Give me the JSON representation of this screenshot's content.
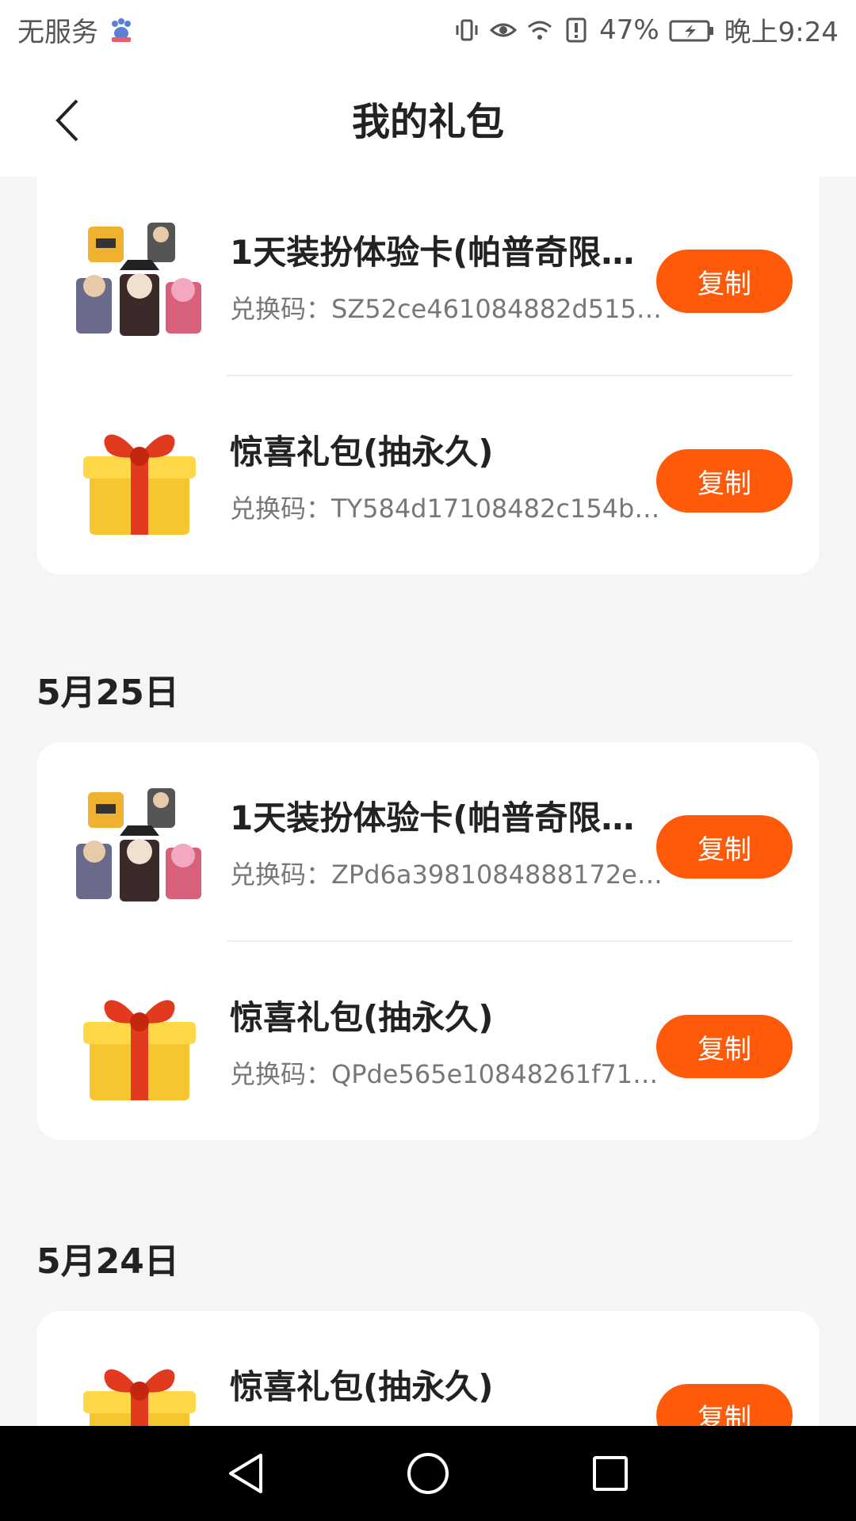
{
  "status_bar": {
    "carrier": "无服务",
    "battery": "47%",
    "time": "晚上9:24"
  },
  "header": {
    "title": "我的礼包"
  },
  "groups": [
    {
      "date": "",
      "items": [
        {
          "title": "1天装扮体验卡(帕普奇限…",
          "code": "兑换码：SZ52ce461084882d515…",
          "button": "复制",
          "icon": "characters-icon"
        },
        {
          "title": "惊喜礼包(抽永久)",
          "code": "兑换码：TY584d17108482c154b…",
          "button": "复制",
          "icon": "gift-box-icon"
        }
      ]
    },
    {
      "date": "5月25日",
      "items": [
        {
          "title": "1天装扮体验卡(帕普奇限…",
          "code": "兑换码：ZPd6a3981084888172e…",
          "button": "复制",
          "icon": "characters-icon"
        },
        {
          "title": "惊喜礼包(抽永久)",
          "code": "兑换码：QPde565e10848261f71…",
          "button": "复制",
          "icon": "gift-box-icon"
        }
      ]
    },
    {
      "date": "5月24日",
      "items": [
        {
          "title": "惊喜礼包(抽永久)",
          "code": "",
          "button": "复制",
          "icon": "gift-box-icon"
        }
      ]
    }
  ],
  "colors": {
    "accent": "#ff5a0a",
    "background": "#f5f5f5",
    "card": "#ffffff"
  }
}
